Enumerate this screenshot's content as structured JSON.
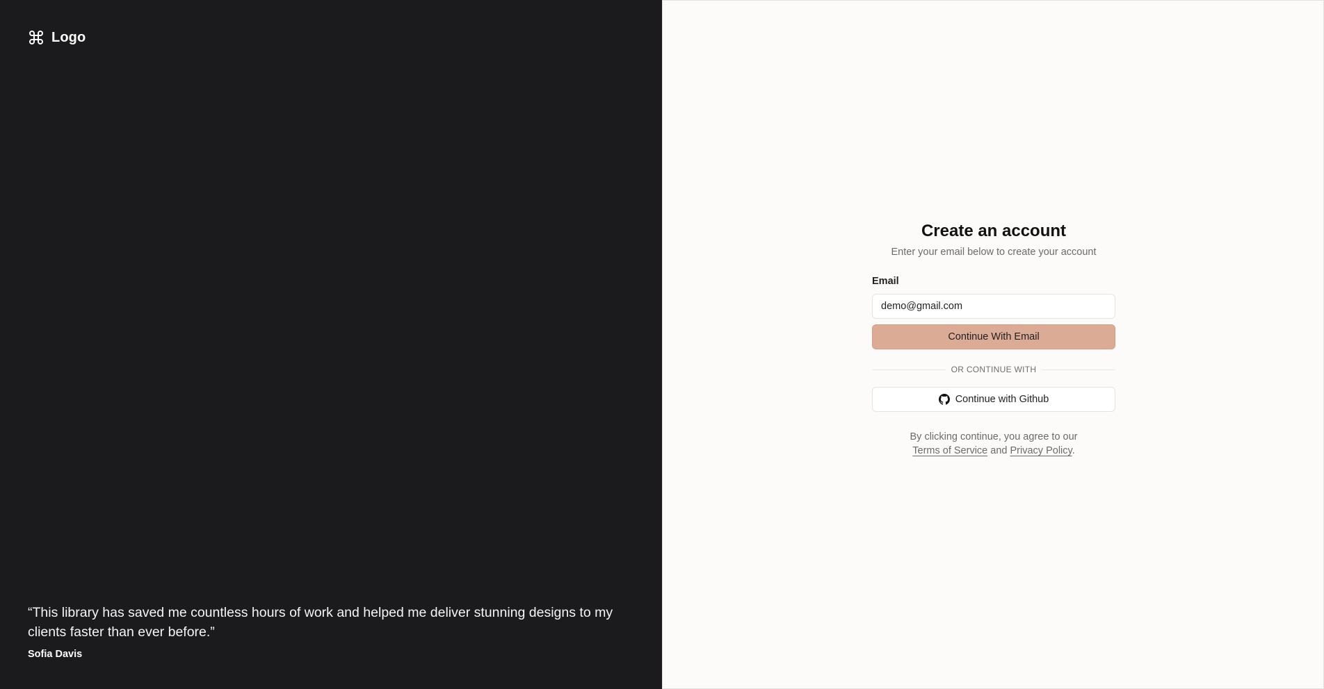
{
  "brand": {
    "name": "Logo",
    "icon": "command-icon"
  },
  "testimonial": {
    "quote": "“This library has saved me countless hours of work and helped me deliver stunning designs to my clients faster than ever before.”",
    "author": "Sofia Davis"
  },
  "form": {
    "title": "Create an account",
    "subtitle": "Enter your email below to create your account",
    "email_label": "Email",
    "email_value": "demo@gmail.com",
    "primary_button": "Continue With Email",
    "divider_text": "OR CONTINUE WITH",
    "github_button": "Continue with Github",
    "github_icon": "github-icon",
    "terms_prefix": "By clicking continue, you agree to our",
    "terms_link": "Terms of Service",
    "terms_and": "and",
    "privacy_link": "Privacy Policy",
    "terms_suffix": "."
  },
  "colors": {
    "left_panel_bg": "#1b1b1d",
    "right_panel_bg": "#fcfbf9",
    "primary_button_bg": "#dcab96"
  }
}
